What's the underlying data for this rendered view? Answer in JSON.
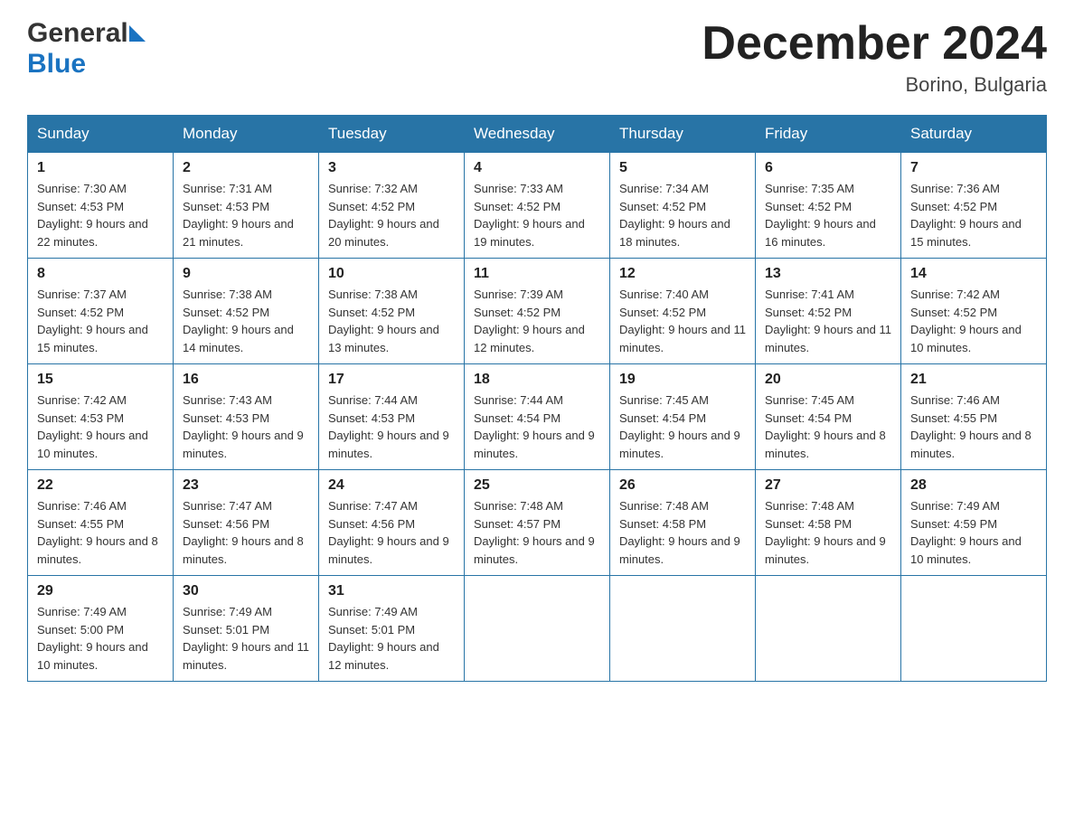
{
  "logo": {
    "general": "General",
    "blue": "Blue",
    "triangle": "▶"
  },
  "header": {
    "month_year": "December 2024",
    "location": "Borino, Bulgaria"
  },
  "weekdays": [
    "Sunday",
    "Monday",
    "Tuesday",
    "Wednesday",
    "Thursday",
    "Friday",
    "Saturday"
  ],
  "weeks": [
    [
      {
        "day": "1",
        "sunrise": "Sunrise: 7:30 AM",
        "sunset": "Sunset: 4:53 PM",
        "daylight": "Daylight: 9 hours and 22 minutes."
      },
      {
        "day": "2",
        "sunrise": "Sunrise: 7:31 AM",
        "sunset": "Sunset: 4:53 PM",
        "daylight": "Daylight: 9 hours and 21 minutes."
      },
      {
        "day": "3",
        "sunrise": "Sunrise: 7:32 AM",
        "sunset": "Sunset: 4:52 PM",
        "daylight": "Daylight: 9 hours and 20 minutes."
      },
      {
        "day": "4",
        "sunrise": "Sunrise: 7:33 AM",
        "sunset": "Sunset: 4:52 PM",
        "daylight": "Daylight: 9 hours and 19 minutes."
      },
      {
        "day": "5",
        "sunrise": "Sunrise: 7:34 AM",
        "sunset": "Sunset: 4:52 PM",
        "daylight": "Daylight: 9 hours and 18 minutes."
      },
      {
        "day": "6",
        "sunrise": "Sunrise: 7:35 AM",
        "sunset": "Sunset: 4:52 PM",
        "daylight": "Daylight: 9 hours and 16 minutes."
      },
      {
        "day": "7",
        "sunrise": "Sunrise: 7:36 AM",
        "sunset": "Sunset: 4:52 PM",
        "daylight": "Daylight: 9 hours and 15 minutes."
      }
    ],
    [
      {
        "day": "8",
        "sunrise": "Sunrise: 7:37 AM",
        "sunset": "Sunset: 4:52 PM",
        "daylight": "Daylight: 9 hours and 15 minutes."
      },
      {
        "day": "9",
        "sunrise": "Sunrise: 7:38 AM",
        "sunset": "Sunset: 4:52 PM",
        "daylight": "Daylight: 9 hours and 14 minutes."
      },
      {
        "day": "10",
        "sunrise": "Sunrise: 7:38 AM",
        "sunset": "Sunset: 4:52 PM",
        "daylight": "Daylight: 9 hours and 13 minutes."
      },
      {
        "day": "11",
        "sunrise": "Sunrise: 7:39 AM",
        "sunset": "Sunset: 4:52 PM",
        "daylight": "Daylight: 9 hours and 12 minutes."
      },
      {
        "day": "12",
        "sunrise": "Sunrise: 7:40 AM",
        "sunset": "Sunset: 4:52 PM",
        "daylight": "Daylight: 9 hours and 11 minutes."
      },
      {
        "day": "13",
        "sunrise": "Sunrise: 7:41 AM",
        "sunset": "Sunset: 4:52 PM",
        "daylight": "Daylight: 9 hours and 11 minutes."
      },
      {
        "day": "14",
        "sunrise": "Sunrise: 7:42 AM",
        "sunset": "Sunset: 4:52 PM",
        "daylight": "Daylight: 9 hours and 10 minutes."
      }
    ],
    [
      {
        "day": "15",
        "sunrise": "Sunrise: 7:42 AM",
        "sunset": "Sunset: 4:53 PM",
        "daylight": "Daylight: 9 hours and 10 minutes."
      },
      {
        "day": "16",
        "sunrise": "Sunrise: 7:43 AM",
        "sunset": "Sunset: 4:53 PM",
        "daylight": "Daylight: 9 hours and 9 minutes."
      },
      {
        "day": "17",
        "sunrise": "Sunrise: 7:44 AM",
        "sunset": "Sunset: 4:53 PM",
        "daylight": "Daylight: 9 hours and 9 minutes."
      },
      {
        "day": "18",
        "sunrise": "Sunrise: 7:44 AM",
        "sunset": "Sunset: 4:54 PM",
        "daylight": "Daylight: 9 hours and 9 minutes."
      },
      {
        "day": "19",
        "sunrise": "Sunrise: 7:45 AM",
        "sunset": "Sunset: 4:54 PM",
        "daylight": "Daylight: 9 hours and 9 minutes."
      },
      {
        "day": "20",
        "sunrise": "Sunrise: 7:45 AM",
        "sunset": "Sunset: 4:54 PM",
        "daylight": "Daylight: 9 hours and 8 minutes."
      },
      {
        "day": "21",
        "sunrise": "Sunrise: 7:46 AM",
        "sunset": "Sunset: 4:55 PM",
        "daylight": "Daylight: 9 hours and 8 minutes."
      }
    ],
    [
      {
        "day": "22",
        "sunrise": "Sunrise: 7:46 AM",
        "sunset": "Sunset: 4:55 PM",
        "daylight": "Daylight: 9 hours and 8 minutes."
      },
      {
        "day": "23",
        "sunrise": "Sunrise: 7:47 AM",
        "sunset": "Sunset: 4:56 PM",
        "daylight": "Daylight: 9 hours and 8 minutes."
      },
      {
        "day": "24",
        "sunrise": "Sunrise: 7:47 AM",
        "sunset": "Sunset: 4:56 PM",
        "daylight": "Daylight: 9 hours and 9 minutes."
      },
      {
        "day": "25",
        "sunrise": "Sunrise: 7:48 AM",
        "sunset": "Sunset: 4:57 PM",
        "daylight": "Daylight: 9 hours and 9 minutes."
      },
      {
        "day": "26",
        "sunrise": "Sunrise: 7:48 AM",
        "sunset": "Sunset: 4:58 PM",
        "daylight": "Daylight: 9 hours and 9 minutes."
      },
      {
        "day": "27",
        "sunrise": "Sunrise: 7:48 AM",
        "sunset": "Sunset: 4:58 PM",
        "daylight": "Daylight: 9 hours and 9 minutes."
      },
      {
        "day": "28",
        "sunrise": "Sunrise: 7:49 AM",
        "sunset": "Sunset: 4:59 PM",
        "daylight": "Daylight: 9 hours and 10 minutes."
      }
    ],
    [
      {
        "day": "29",
        "sunrise": "Sunrise: 7:49 AM",
        "sunset": "Sunset: 5:00 PM",
        "daylight": "Daylight: 9 hours and 10 minutes."
      },
      {
        "day": "30",
        "sunrise": "Sunrise: 7:49 AM",
        "sunset": "Sunset: 5:01 PM",
        "daylight": "Daylight: 9 hours and 11 minutes."
      },
      {
        "day": "31",
        "sunrise": "Sunrise: 7:49 AM",
        "sunset": "Sunset: 5:01 PM",
        "daylight": "Daylight: 9 hours and 12 minutes."
      },
      null,
      null,
      null,
      null
    ]
  ]
}
